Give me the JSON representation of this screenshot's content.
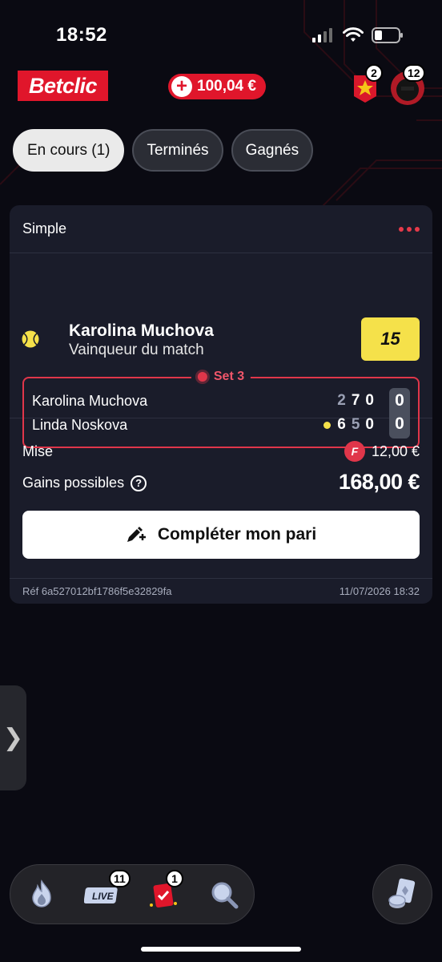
{
  "status_bar": {
    "time": "18:52"
  },
  "header": {
    "logo": "Betclic",
    "balance": "100,04 €",
    "rewards_count": "2",
    "profile_count": "12"
  },
  "tabs": [
    {
      "label": "En cours (1)",
      "active": true
    },
    {
      "label": "Terminés",
      "active": false
    },
    {
      "label": "Gagnés",
      "active": false
    }
  ],
  "bet": {
    "type": "Simple",
    "selection": "Karolina Muchova",
    "market": "Vainqueur du match",
    "odds": "15",
    "live_label": "Set 3",
    "players": [
      {
        "name": "Karolina Muchova",
        "sets": [
          "2",
          "7",
          "0"
        ],
        "game": "0",
        "serving": false
      },
      {
        "name": "Linda Noskova",
        "sets": [
          "6",
          "5",
          "0"
        ],
        "game": "0",
        "serving": true
      }
    ],
    "stake_label": "Mise",
    "stake_value": "12,00 €",
    "freebet_chip": "F",
    "winnings_label": "Gains possibles",
    "winnings_value": "168,00 €",
    "cta_label": "Compléter mon pari",
    "ref": "Réf 6a527012bf1786f5e32829fa",
    "date": "11/07/2026 18:32"
  },
  "bottom_nav": {
    "live_text": "LIVE",
    "live_count": "11",
    "bets_count": "1"
  },
  "colors": {
    "brand": "#e0162b",
    "odds": "#f5e14a",
    "background": "#0a0a12",
    "card": "#1a1c2a"
  }
}
